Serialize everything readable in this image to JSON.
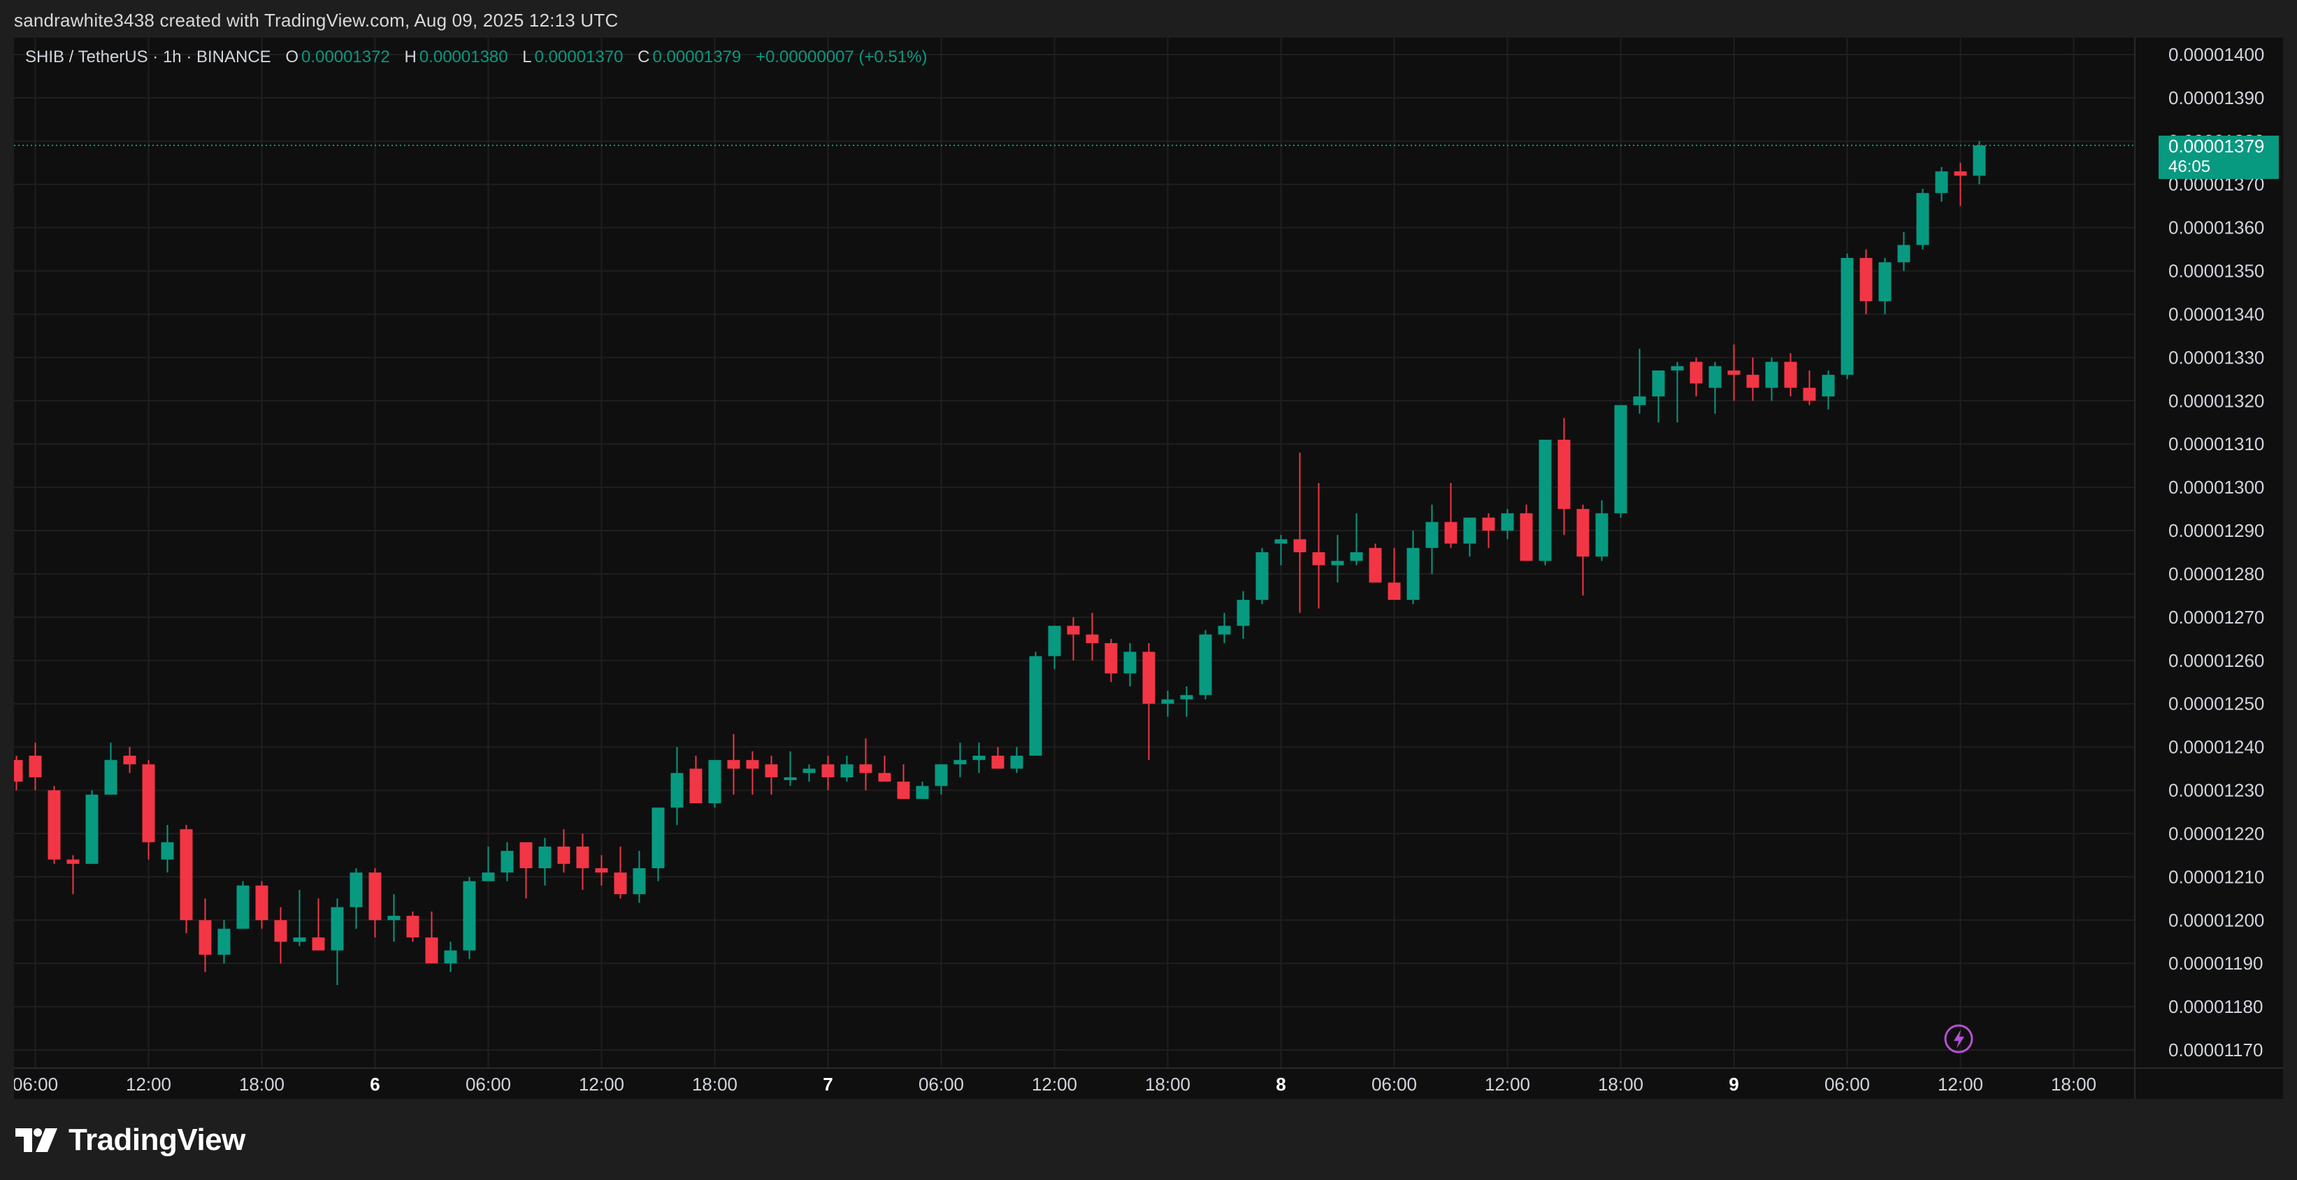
{
  "header": {
    "caption": "sandrawhite3438 created with TradingView.com, Aug 09, 2025 12:13 UTC"
  },
  "legend": {
    "symbol": "SHIB / TetherUS · 1h · BINANCE",
    "o_label": "O",
    "o_value": "0.00001372",
    "h_label": "H",
    "h_value": "0.00001380",
    "l_label": "L",
    "l_value": "0.00001370",
    "c_label": "C",
    "c_value": "0.00001379",
    "change": "+0.00000007 (+0.51%)"
  },
  "price_badge": {
    "price": "0.00001379",
    "countdown": "46:05"
  },
  "footer": {
    "brand": "TradingView"
  },
  "colors": {
    "up": "#089981",
    "down": "#f23645",
    "background": "#0f0f0f",
    "frame": "#1e1e1e",
    "grid": "#1f1f1f",
    "text": "#d1d4dc",
    "lightning": "#b84fd6"
  },
  "icons": {
    "logo": "tradingview-logo-icon",
    "alert": "lightning-icon"
  },
  "chart_data": {
    "type": "candlestick",
    "series_name": "SHIB / TetherUS",
    "interval": "1h",
    "y_unit": "USDT",
    "ylim": [
      1.17e-05,
      1.4e-05
    ],
    "y_ticks": [
      "0.00001170",
      "0.00001180",
      "0.00001190",
      "0.00001200",
      "0.00001210",
      "0.00001220",
      "0.00001230",
      "0.00001240",
      "0.00001250",
      "0.00001260",
      "0.00001270",
      "0.00001280",
      "0.00001290",
      "0.00001300",
      "0.00001310",
      "0.00001320",
      "0.00001330",
      "0.00001340",
      "0.00001350",
      "0.00001360",
      "0.00001370",
      "0.00001380",
      "0.00001390",
      "0.00001400"
    ],
    "x_ticks": [
      {
        "label": "06:00",
        "bold": false,
        "hour_index": 1
      },
      {
        "label": "12:00",
        "bold": false,
        "hour_index": 7
      },
      {
        "label": "18:00",
        "bold": false,
        "hour_index": 13
      },
      {
        "label": "6",
        "bold": true,
        "hour_index": 19
      },
      {
        "label": "06:00",
        "bold": false,
        "hour_index": 25
      },
      {
        "label": "12:00",
        "bold": false,
        "hour_index": 31
      },
      {
        "label": "18:00",
        "bold": false,
        "hour_index": 37
      },
      {
        "label": "7",
        "bold": true,
        "hour_index": 43
      },
      {
        "label": "06:00",
        "bold": false,
        "hour_index": 49
      },
      {
        "label": "12:00",
        "bold": false,
        "hour_index": 55
      },
      {
        "label": "18:00",
        "bold": false,
        "hour_index": 61
      },
      {
        "label": "8",
        "bold": true,
        "hour_index": 67
      },
      {
        "label": "06:00",
        "bold": false,
        "hour_index": 73
      },
      {
        "label": "12:00",
        "bold": false,
        "hour_index": 79
      },
      {
        "label": "18:00",
        "bold": false,
        "hour_index": 85
      },
      {
        "label": "9",
        "bold": true,
        "hour_index": 91
      },
      {
        "label": "06:00",
        "bold": false,
        "hour_index": 97
      },
      {
        "label": "12:00",
        "bold": false,
        "hour_index": 103
      },
      {
        "label": "18:00",
        "bold": false,
        "hour_index": 109
      }
    ],
    "grid": true,
    "last_price_line": 1.379e-05,
    "price_scale_unit": 1e-08,
    "candles_ohlc": [
      [
        1237,
        1238,
        1230,
        1232
      ],
      [
        1238,
        1241,
        1230,
        1233
      ],
      [
        1230,
        1231,
        1213,
        1214
      ],
      [
        1214,
        1215,
        1206,
        1213
      ],
      [
        1213,
        1230,
        1213,
        1229
      ],
      [
        1229,
        1241,
        1229,
        1237
      ],
      [
        1238,
        1240,
        1234,
        1236
      ],
      [
        1236,
        1237,
        1214,
        1218
      ],
      [
        1214,
        1222,
        1211,
        1218
      ],
      [
        1221,
        1222,
        1197,
        1200
      ],
      [
        1200,
        1205,
        1188,
        1192
      ],
      [
        1192,
        1200,
        1190,
        1198
      ],
      [
        1198,
        1209,
        1198,
        1208
      ],
      [
        1208,
        1209,
        1198,
        1200
      ],
      [
        1200,
        1203,
        1190,
        1195
      ],
      [
        1195,
        1207,
        1194,
        1196
      ],
      [
        1196,
        1205,
        1193,
        1193
      ],
      [
        1193,
        1205,
        1185,
        1203
      ],
      [
        1203,
        1212,
        1198,
        1211
      ],
      [
        1211,
        1212,
        1196,
        1200
      ],
      [
        1200,
        1206,
        1195,
        1201
      ],
      [
        1201,
        1202,
        1195,
        1196
      ],
      [
        1196,
        1202,
        1192,
        1190
      ],
      [
        1190,
        1195,
        1188,
        1193
      ],
      [
        1193,
        1210,
        1191,
        1209
      ],
      [
        1209,
        1217,
        1209,
        1211
      ],
      [
        1211,
        1218,
        1209,
        1216
      ],
      [
        1218,
        1218,
        1205,
        1212
      ],
      [
        1212,
        1219,
        1208,
        1217
      ],
      [
        1217,
        1221,
        1211,
        1213
      ],
      [
        1217,
        1220,
        1207,
        1212
      ],
      [
        1212,
        1215,
        1208,
        1211
      ],
      [
        1211,
        1217,
        1205,
        1206
      ],
      [
        1206,
        1216,
        1204,
        1212
      ],
      [
        1212,
        1226,
        1209,
        1226
      ],
      [
        1226,
        1240,
        1222,
        1234
      ],
      [
        1235,
        1238,
        1229,
        1227
      ],
      [
        1227,
        1235,
        1226,
        1237
      ],
      [
        1237,
        1243,
        1229,
        1235
      ],
      [
        1237,
        1239,
        1229,
        1235
      ],
      [
        1236,
        1238,
        1229,
        1233
      ],
      [
        1233,
        1239,
        1231,
        1233
      ],
      [
        1234,
        1236,
        1232,
        1235
      ],
      [
        1236,
        1238,
        1230,
        1233
      ],
      [
        1233,
        1238,
        1232,
        1236
      ],
      [
        1236,
        1242,
        1230,
        1234
      ],
      [
        1234,
        1238,
        1232,
        1232
      ],
      [
        1232,
        1236,
        1228,
        1228
      ],
      [
        1228,
        1232,
        1228,
        1231
      ],
      [
        1231,
        1236,
        1229,
        1236
      ],
      [
        1236,
        1241,
        1233,
        1237
      ],
      [
        1237,
        1241,
        1234,
        1238
      ],
      [
        1238,
        1240,
        1236,
        1235
      ],
      [
        1235,
        1240,
        1234,
        1238
      ],
      [
        1238,
        1262,
        1238,
        1261
      ],
      [
        1261,
        1268,
        1258,
        1268
      ],
      [
        1268,
        1270,
        1260,
        1266
      ],
      [
        1266,
        1271,
        1260,
        1264
      ],
      [
        1264,
        1265,
        1255,
        1257
      ],
      [
        1257,
        1264,
        1254,
        1262
      ],
      [
        1262,
        1264,
        1237,
        1250
      ],
      [
        1250,
        1253,
        1247,
        1251
      ],
      [
        1251,
        1254,
        1247,
        1252
      ],
      [
        1252,
        1267,
        1251,
        1266
      ],
      [
        1266,
        1271,
        1264,
        1268
      ],
      [
        1268,
        1276,
        1265,
        1274
      ],
      [
        1274,
        1286,
        1273,
        1285
      ],
      [
        1287,
        1289,
        1282,
        1288
      ],
      [
        1288,
        1308,
        1271,
        1285
      ],
      [
        1285,
        1301,
        1272,
        1282
      ],
      [
        1282,
        1289,
        1278,
        1283
      ],
      [
        1283,
        1294,
        1282,
        1285
      ],
      [
        1286,
        1287,
        1278,
        1278
      ],
      [
        1278,
        1286,
        1275,
        1274
      ],
      [
        1274,
        1290,
        1273,
        1286
      ],
      [
        1286,
        1296,
        1280,
        1292
      ],
      [
        1292,
        1301,
        1286,
        1287
      ],
      [
        1287,
        1293,
        1284,
        1293
      ],
      [
        1293,
        1294,
        1286,
        1290
      ],
      [
        1290,
        1295,
        1288,
        1294
      ],
      [
        1294,
        1296,
        1283,
        1283
      ],
      [
        1283,
        1310,
        1282,
        1311
      ],
      [
        1311,
        1316,
        1289,
        1295
      ],
      [
        1295,
        1296,
        1275,
        1284
      ],
      [
        1284,
        1297,
        1283,
        1294
      ],
      [
        1294,
        1318,
        1293,
        1319
      ],
      [
        1319,
        1332,
        1317,
        1321
      ],
      [
        1321,
        1327,
        1315,
        1327
      ],
      [
        1327,
        1329,
        1315,
        1328
      ],
      [
        1329,
        1330,
        1321,
        1324
      ],
      [
        1323,
        1329,
        1317,
        1328
      ],
      [
        1327,
        1333,
        1320,
        1326
      ],
      [
        1326,
        1330,
        1320,
        1323
      ],
      [
        1323,
        1330,
        1320,
        1329
      ],
      [
        1329,
        1331,
        1321,
        1323
      ],
      [
        1323,
        1327,
        1319,
        1320
      ],
      [
        1321,
        1327,
        1318,
        1326
      ],
      [
        1326,
        1354,
        1325,
        1353
      ],
      [
        1353,
        1355,
        1340,
        1343
      ],
      [
        1343,
        1353,
        1340,
        1352
      ],
      [
        1352,
        1359,
        1350,
        1356
      ],
      [
        1356,
        1369,
        1355,
        1368
      ],
      [
        1368,
        1374,
        1366,
        1373
      ],
      [
        1373,
        1375,
        1365,
        1372
      ],
      [
        1372,
        1380,
        1370,
        1379
      ]
    ]
  }
}
